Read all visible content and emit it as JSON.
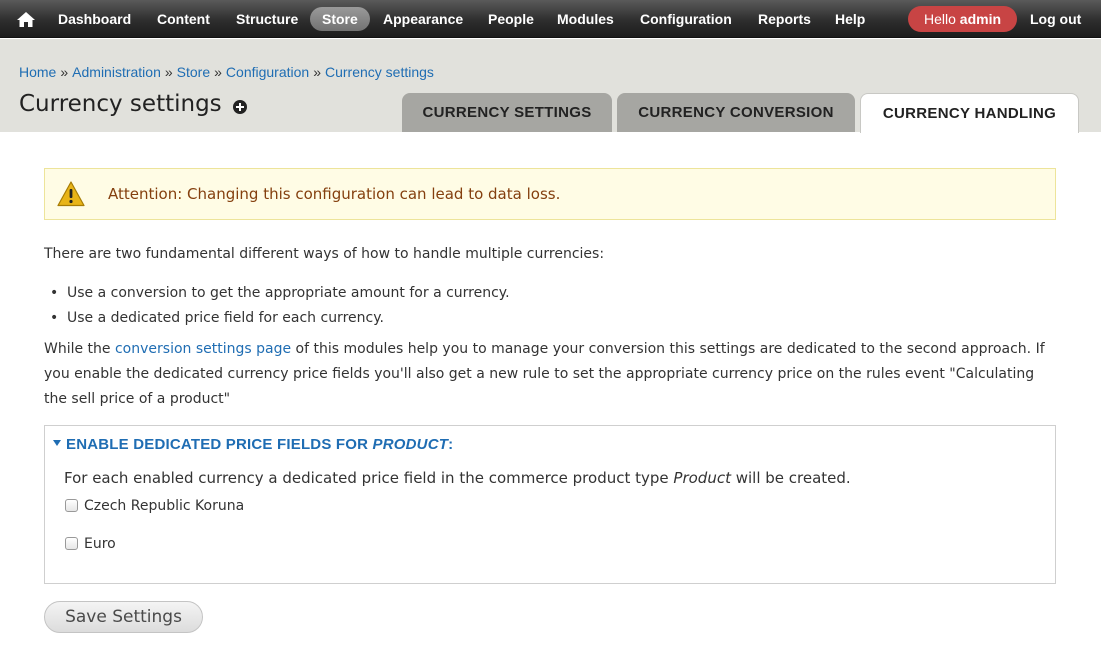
{
  "toolbar": {
    "home_icon": "home-icon",
    "items": [
      {
        "label": "Dashboard"
      },
      {
        "label": "Content"
      },
      {
        "label": "Structure"
      },
      {
        "label": "Store",
        "active": true
      },
      {
        "label": "Appearance"
      },
      {
        "label": "People"
      },
      {
        "label": "Modules"
      },
      {
        "label": "Configuration"
      },
      {
        "label": "Reports"
      },
      {
        "label": "Help"
      }
    ],
    "hello_prefix": "Hello ",
    "hello_user": "admin",
    "logout": "Log out",
    "hello_color": "#c84444"
  },
  "breadcrumb": {
    "items": [
      "Home",
      "Administration",
      "Store",
      "Configuration",
      "Currency settings"
    ],
    "separator": "»"
  },
  "page": {
    "title": "Currency settings",
    "add_shortcut_icon": "plus-circle-icon"
  },
  "tabs": [
    {
      "label": "CURRENCY SETTINGS",
      "active": false
    },
    {
      "label": "CURRENCY CONVERSION",
      "active": false
    },
    {
      "label": "CURRENCY HANDLING",
      "active": true
    }
  ],
  "warning": {
    "icon": "warning-triangle-icon",
    "text": "Attention: Changing this configuration can lead to data loss."
  },
  "content": {
    "intro": "There are two fundamental different ways of how to handle multiple currencies:",
    "bullets": [
      "Use a conversion to get the appropriate amount for a currency.",
      "Use a dedicated price field for each currency."
    ],
    "para_before_link": "While the ",
    "para_link": "conversion settings page",
    "para_after_link": " of this modules help you to manage your conversion this settings are dedicated to the second approach. If you enable the dedicated currency price fields you'll also get a new rule to set the appropriate currency price on the rules event \"Calculating the sell price of a product\""
  },
  "fieldset": {
    "legend_prefix": "ENABLE DEDICATED PRICE FIELDS FOR ",
    "legend_italic": "PRODUCT",
    "legend_suffix": ":",
    "desc_prefix": "For each enabled currency a dedicated price field in the commerce product type ",
    "desc_italic": "Product",
    "desc_suffix": " will be created.",
    "options": [
      {
        "label": "Czech Republic Koruna",
        "checked": false
      },
      {
        "label": "Euro",
        "checked": false
      }
    ]
  },
  "actions": {
    "save": "Save Settings"
  },
  "colors": {
    "link": "#1f6db3",
    "warning_bg": "#fffce5",
    "warning_text": "#843f0e",
    "header_band": "#e1e1dc"
  }
}
